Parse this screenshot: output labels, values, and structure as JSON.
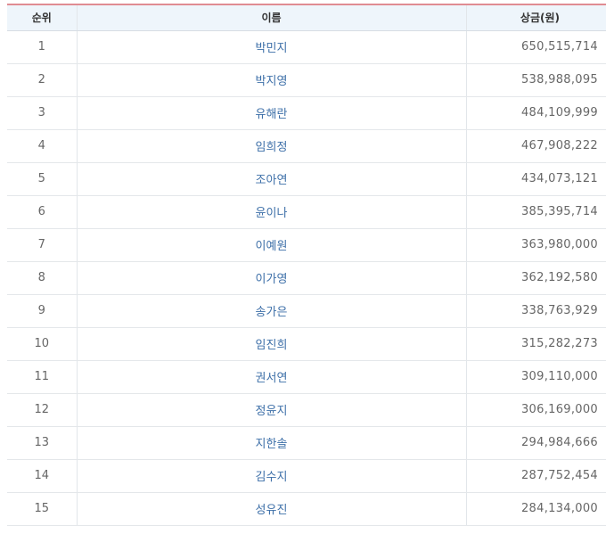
{
  "table": {
    "headers": {
      "rank": "순위",
      "name": "이름",
      "prize": "상금(원)"
    },
    "rows": [
      {
        "rank": "1",
        "name": "박민지",
        "prize": "650,515,714"
      },
      {
        "rank": "2",
        "name": "박지영",
        "prize": "538,988,095"
      },
      {
        "rank": "3",
        "name": "유해란",
        "prize": "484,109,999"
      },
      {
        "rank": "4",
        "name": "임희정",
        "prize": "467,908,222"
      },
      {
        "rank": "5",
        "name": "조아연",
        "prize": "434,073,121"
      },
      {
        "rank": "6",
        "name": "윤이나",
        "prize": "385,395,714"
      },
      {
        "rank": "7",
        "name": "이예원",
        "prize": "363,980,000"
      },
      {
        "rank": "8",
        "name": "이가영",
        "prize": "362,192,580"
      },
      {
        "rank": "9",
        "name": "송가은",
        "prize": "338,763,929"
      },
      {
        "rank": "10",
        "name": "임진희",
        "prize": "315,282,273"
      },
      {
        "rank": "11",
        "name": "권서연",
        "prize": "309,110,000"
      },
      {
        "rank": "12",
        "name": "정윤지",
        "prize": "306,169,000"
      },
      {
        "rank": "13",
        "name": "지한솔",
        "prize": "294,984,666"
      },
      {
        "rank": "14",
        "name": "김수지",
        "prize": "287,752,454"
      },
      {
        "rank": "15",
        "name": "성유진",
        "prize": "284,134,000"
      }
    ]
  },
  "colors": {
    "header_background": "#eef5fb",
    "header_top_border": "#e08c92",
    "name_text": "#3d6fa8",
    "value_text": "#666666"
  }
}
